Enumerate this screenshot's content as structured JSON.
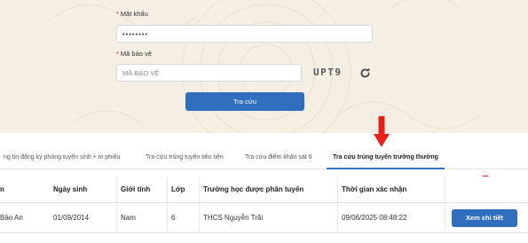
{
  "form": {
    "password_label": "Mật khẩu",
    "password_value": "••••••••",
    "captcha_label": "Mã bảo vệ",
    "captcha_placeholder": "MÃ BẢO VỆ",
    "captcha_code": "UPT9",
    "submit_label": "Tra cứu",
    "required_mark": "*"
  },
  "tabs": [
    {
      "label": "ng tin đăng ký phòng tuyển sinh + in phiếu",
      "active": false
    },
    {
      "label": "Tra cứu trúng tuyển tiên tiến",
      "active": false
    },
    {
      "label": "Tra cứu điểm khảo sát 6",
      "active": false
    },
    {
      "label": "Tra cứu trúng tuyển trường thường",
      "active": true
    }
  ],
  "table": {
    "headers": [
      "n",
      "Ngày sinh",
      "Giới tính",
      "Lớp",
      "Trường học được phân tuyến",
      "Thời gian xác nhận",
      ""
    ],
    "rows": [
      {
        "name": "Bảo An",
        "dob": "01/09/2014",
        "gender": "Nam",
        "grade": "6",
        "school": "THCS Nguyễn Trãi",
        "confirmed_at": "09/06/2025 08:48:22",
        "action_label": "Xem chi tiết"
      }
    ]
  },
  "colors": {
    "primary": "#2f6fbe",
    "annotation": "#e8221b",
    "form_background": "#f6efe4"
  },
  "icons": {
    "refresh": "refresh-icon",
    "annotation": "red-arrow-down-icon"
  }
}
